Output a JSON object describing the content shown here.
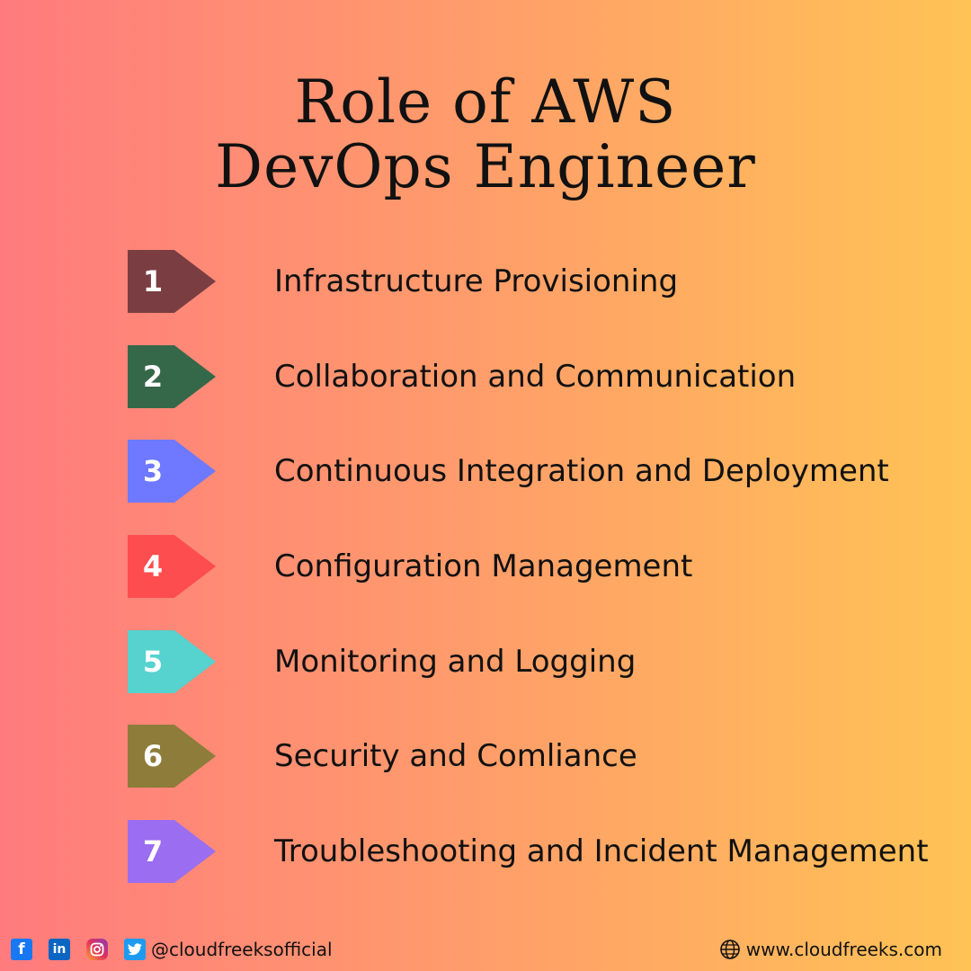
{
  "title": {
    "line1": "Role of AWS",
    "line2": "DevOps Engineer"
  },
  "items": [
    {
      "number": "1",
      "label": "Infrastructure Provisioning",
      "color": "#7a3e42"
    },
    {
      "number": "2",
      "label": "Collaboration and Communication",
      "color": "#356849"
    },
    {
      "number": "3",
      "label": "Continuous Integration and Deployment",
      "color": "#6e79ff"
    },
    {
      "number": "4",
      "label": "Configuration Management",
      "color": "#fd4d4e"
    },
    {
      "number": "5",
      "label": "Monitoring and Logging",
      "color": "#56d2cf"
    },
    {
      "number": "6",
      "label": "Security and Comliance",
      "color": "#8e7c3a"
    },
    {
      "number": "7",
      "label": "Troubleshooting and Incident Management",
      "color": "#9b6df0"
    }
  ],
  "footer": {
    "icons": [
      "facebook-icon",
      "linkedin-icon",
      "instagram-icon",
      "twitter-icon"
    ],
    "handle": "@cloudfreeksofficial",
    "website": "www.cloudfreeks.com",
    "website_icon": "globe-icon"
  }
}
